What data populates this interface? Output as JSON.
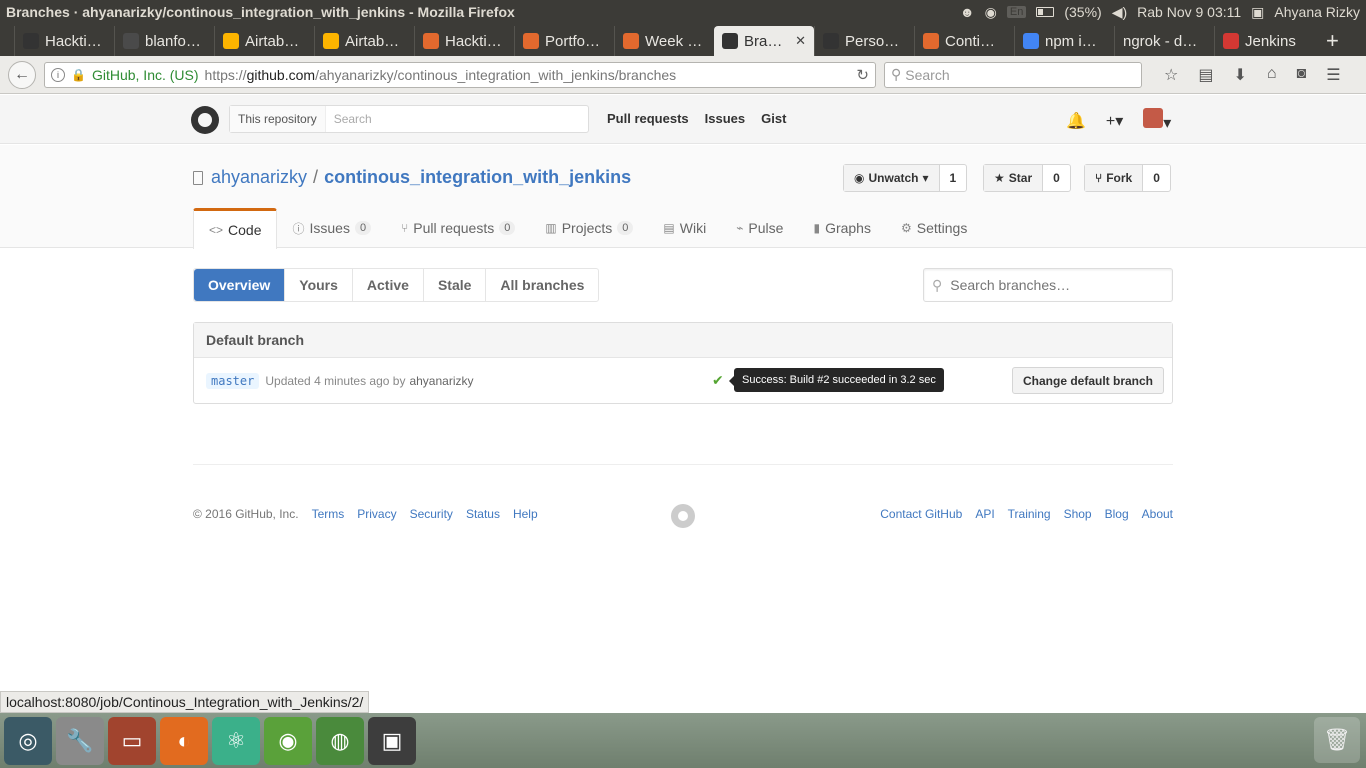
{
  "os": {
    "window_title": "Branches · ahyanarizky/continous_integration_with_jenkins - Mozilla Firefox",
    "keyboard": "En",
    "battery": "(35%)",
    "datetime": "Rab Nov  9 03:11",
    "user": "Ahyana Rizky"
  },
  "tabs": [
    {
      "label": "Hackti…",
      "icon": "github-icon",
      "color": "#333333"
    },
    {
      "label": "blanfo…",
      "icon": "slack-icon",
      "color": "#4a4a4a"
    },
    {
      "label": "Airtab…",
      "icon": "airtable-icon",
      "color": "#fcb400"
    },
    {
      "label": "Airtab…",
      "icon": "airtable-icon",
      "color": "#fcb400"
    },
    {
      "label": "Hackti…",
      "icon": "gitlab-icon",
      "color": "#e2692e"
    },
    {
      "label": "Portfo…",
      "icon": "gitlab-icon",
      "color": "#e2692e"
    },
    {
      "label": "Week …",
      "icon": "gitlab-icon",
      "color": "#e2692e"
    },
    {
      "label": "Bra…",
      "icon": "github-icon",
      "color": "#333333",
      "active": true
    },
    {
      "label": "Perso…",
      "icon": "github-icon",
      "color": "#333333"
    },
    {
      "label": "Conti…",
      "icon": "gitlab-icon",
      "color": "#e2692e"
    },
    {
      "label": "npm i…",
      "icon": "google-icon",
      "color": "#4285f4"
    },
    {
      "label": "ngrok - d…",
      "icon": "",
      "color": ""
    },
    {
      "label": "Jenkins",
      "icon": "jenkins-icon",
      "color": "#d33833"
    }
  ],
  "browser": {
    "org": "GitHub, Inc. (US)",
    "url_prefix": "https://",
    "url_host": "github.com",
    "url_path": "/ahyanarizky/continous_integration_with_jenkins/branches",
    "search_placeholder": "Search"
  },
  "gh_header": {
    "scope_label": "This repository",
    "search_placeholder": "Search",
    "links": [
      "Pull requests",
      "Issues",
      "Gist"
    ]
  },
  "repo": {
    "owner": "ahyanarizky",
    "separator": "/",
    "name": "continous_integration_with_jenkins",
    "watch_label": "Unwatch",
    "watch_count": "1",
    "star_label": "Star",
    "star_count": "0",
    "fork_label": "Fork",
    "fork_count": "0"
  },
  "repo_nav": [
    {
      "label": "Code",
      "icon": "code-icon",
      "glyph": "<>",
      "counter": "",
      "selected": true
    },
    {
      "label": "Issues",
      "icon": "issue-icon",
      "glyph": "ⓘ",
      "counter": "0"
    },
    {
      "label": "Pull requests",
      "icon": "pull-request-icon",
      "glyph": "⑂",
      "counter": "0"
    },
    {
      "label": "Projects",
      "icon": "projects-icon",
      "glyph": "▥",
      "counter": "0"
    },
    {
      "label": "Wiki",
      "icon": "wiki-icon",
      "glyph": "▤",
      "counter": ""
    },
    {
      "label": "Pulse",
      "icon": "pulse-icon",
      "glyph": "⌁",
      "counter": ""
    },
    {
      "label": "Graphs",
      "icon": "graph-icon",
      "glyph": "▮",
      "counter": ""
    },
    {
      "label": "Settings",
      "icon": "gear-icon",
      "glyph": "⚙",
      "counter": ""
    }
  ],
  "branch_tabs": [
    "Overview",
    "Yours",
    "Active",
    "Stale",
    "All branches"
  ],
  "branch_search_placeholder": "Search branches…",
  "default_branch": {
    "heading": "Default branch",
    "name": "master",
    "updated": "Updated 4 minutes ago by",
    "author": "ahyanarizky",
    "status_tooltip": "Success: Build #2 succeeded in 3.2 sec",
    "change_button": "Change default branch"
  },
  "footer": {
    "copyright": "© 2016 GitHub, Inc.",
    "left_links": [
      "Terms",
      "Privacy",
      "Security",
      "Status",
      "Help"
    ],
    "right_links": [
      "Contact GitHub",
      "API",
      "Training",
      "Shop",
      "Blog",
      "About"
    ]
  },
  "statusbar": "localhost:8080/job/Continous_Integration_with_Jenkins/2/",
  "launcher": [
    {
      "icon": "ubuntu-dash-icon",
      "color": "#3b5a66"
    },
    {
      "icon": "system-settings-icon",
      "color": "#8a8a8a"
    },
    {
      "icon": "files-icon",
      "color": "#a1442e"
    },
    {
      "icon": "firefox-icon",
      "color": "#e26b1f"
    },
    {
      "icon": "atom-icon",
      "color": "#3bb08a"
    },
    {
      "icon": "android-icon",
      "color": "#5aa13a"
    },
    {
      "icon": "chrome-icon",
      "color": "#4a8a3c"
    },
    {
      "icon": "screen-lock-icon",
      "color": "#3d3d3d"
    }
  ]
}
